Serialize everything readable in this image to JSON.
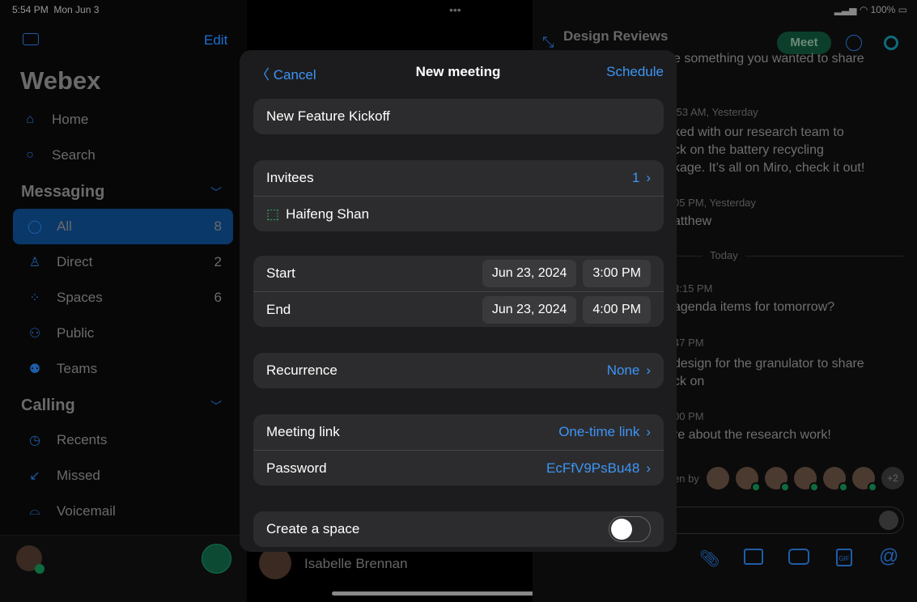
{
  "status": {
    "time": "5:54 PM",
    "date": "Mon Jun 3",
    "battery": "100%"
  },
  "sidebar": {
    "edit": "Edit",
    "title": "Webex",
    "top": [
      {
        "label": "Home",
        "icon": "home-icon"
      },
      {
        "label": "Search",
        "icon": "search-icon"
      }
    ],
    "messaging_header": "Messaging",
    "messaging": [
      {
        "label": "All",
        "count": "8",
        "icon": "chat-icon",
        "selected": true
      },
      {
        "label": "Direct",
        "count": "2",
        "icon": "person-icon"
      },
      {
        "label": "Spaces",
        "count": "6",
        "icon": "spaces-icon"
      },
      {
        "label": "Public",
        "count": "",
        "icon": "public-icon"
      },
      {
        "label": "Teams",
        "count": "",
        "icon": "teams-icon"
      }
    ],
    "calling_header": "Calling",
    "calling": [
      {
        "label": "Recents",
        "icon": "clock-icon"
      },
      {
        "label": "Missed",
        "icon": "missed-call-icon"
      },
      {
        "label": "Voicemail",
        "icon": "voicemail-icon"
      }
    ]
  },
  "middle": {
    "contact": "Isabelle Brennan"
  },
  "chat": {
    "title": "Design Reviews",
    "meet": "Meet",
    "messages": [
      {
        "text": "e something you wanted to share"
      },
      {
        "ts": ":53 AM, Yesterday",
        "lines": [
          "ked with our research team to",
          "ck on the battery recycling",
          "kage. It’s all on Miro, check it out!"
        ]
      },
      {
        "ts": "05 PM, Yesterday",
        "lines": [
          "atthew"
        ]
      },
      {
        "ts": "3:15 PM",
        "lines": [
          "agenda items for tomorrow?"
        ]
      },
      {
        "ts": "47 PM",
        "lines": [
          "design for the granulator to share",
          "ck on"
        ]
      },
      {
        "ts": "00 PM",
        "lines": [
          "re about the research work!"
        ]
      }
    ],
    "divider": "Today",
    "seen_by": "en by",
    "more": "+2"
  },
  "modal": {
    "cancel": "Cancel",
    "title": "New meeting",
    "schedule": "Schedule",
    "meeting_title": "New Feature Kickoff",
    "invitees_label": "Invitees",
    "invitees_count": "1",
    "invitee": "Haifeng Shan",
    "start_label": "Start",
    "start_date": "Jun 23, 2024",
    "start_time": "3:00 PM",
    "end_label": "End",
    "end_date": "Jun 23, 2024",
    "end_time": "4:00 PM",
    "recurrence_label": "Recurrence",
    "recurrence": "None",
    "link_label": "Meeting link",
    "link": "One-time link",
    "password_label": "Password",
    "password": "EcFfV9PsBu48",
    "space_label": "Create a space",
    "create_space": false
  },
  "colors": {
    "accent": "#3d95f5",
    "modal_bg": "#1c1c1e",
    "row_bg": "#2c2c2e"
  }
}
